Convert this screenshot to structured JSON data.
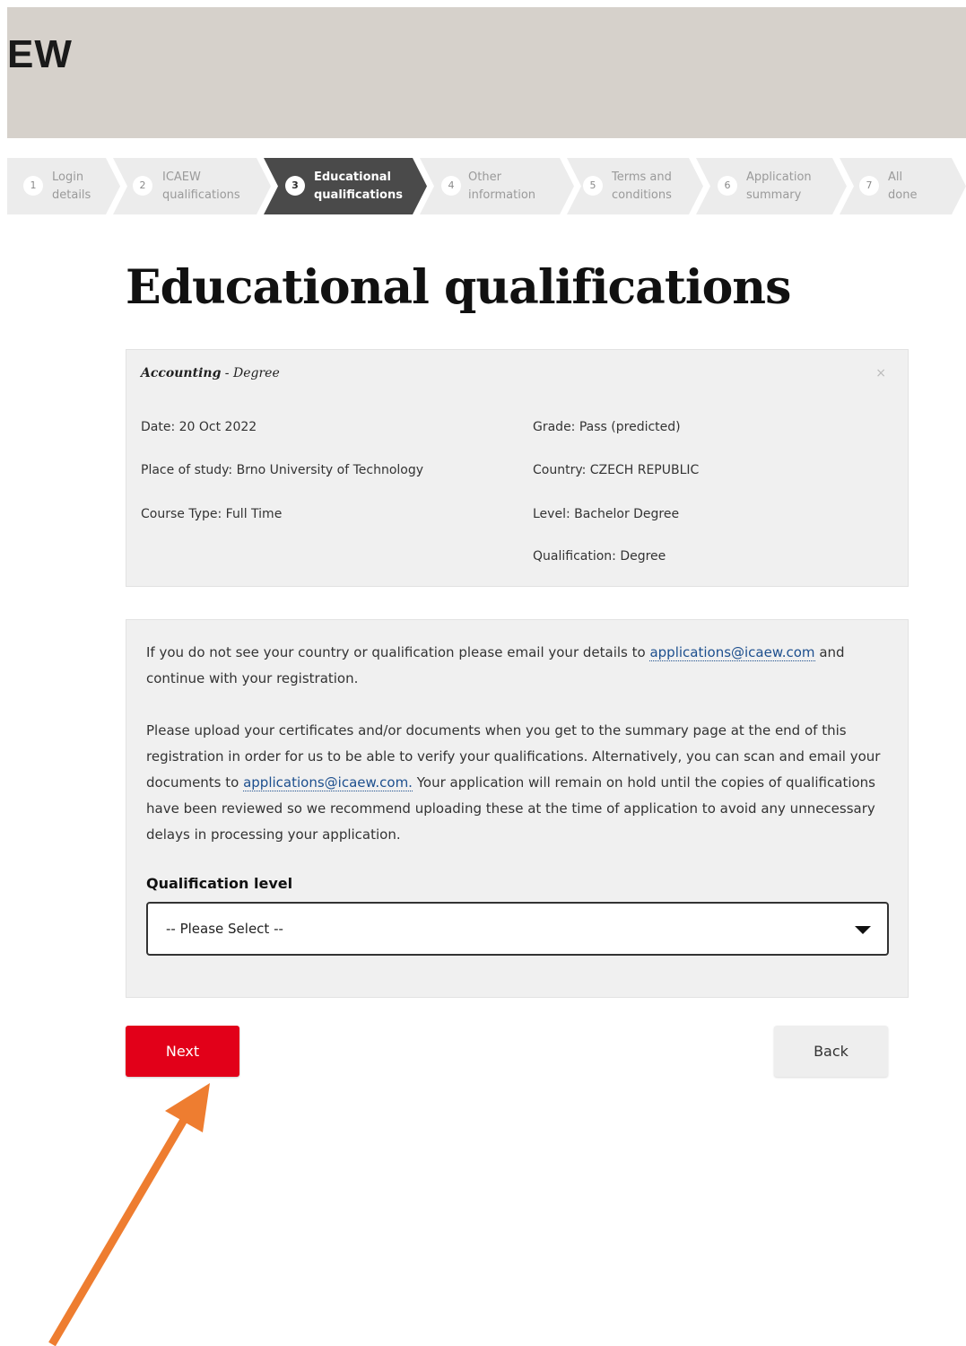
{
  "header": {
    "logo_text": "EW"
  },
  "steps": [
    {
      "num": "1",
      "line1": "Login",
      "line2": "details"
    },
    {
      "num": "2",
      "line1": "ICAEW",
      "line2": "qualifications"
    },
    {
      "num": "3",
      "line1": "Educational",
      "line2": "qualifications"
    },
    {
      "num": "4",
      "line1": "Other",
      "line2": "information"
    },
    {
      "num": "5",
      "line1": "Terms and",
      "line2": "conditions"
    },
    {
      "num": "6",
      "line1": "Application",
      "line2": "summary"
    },
    {
      "num": "7",
      "line1": "All",
      "line2": "done"
    }
  ],
  "active_step": 3,
  "page": {
    "title": "Educational qualifications"
  },
  "qualification": {
    "subject": "Accounting",
    "separator": " - ",
    "type": "Degree",
    "close_symbol": "×",
    "date": "Date: 20 Oct 2022",
    "grade": "Grade: Pass (predicted)",
    "place": "Place of study: Brno University of Technology",
    "country": "Country: CZECH REPUBLIC",
    "course_type": "Course Type: Full Time",
    "level": "Level: Bachelor Degree",
    "qualification": "Qualification: Degree"
  },
  "info": {
    "p1_text": "If you do not see your country or qualification please email your details to ",
    "email": "applications@icaew.com",
    "p1_tail": " and continue with your registration.",
    "p2_text": "Please upload your certificates and/or documents when you get to the summary page at the end of this registration in order for us to be able to verify your qualifications. Alternatively, you can scan and email your documents to ",
    "email2": "applications@icaew.com.",
    "p2_tail": " Your application will remain on hold until the copies of qualifications have been reviewed so we recommend uploading these at the time of application to avoid any unnecessary delays in processing your application.",
    "field_label": "Qualification level",
    "select_value": "-- Please Select --"
  },
  "buttons": {
    "next": "Next",
    "back": "Back"
  },
  "colors": {
    "accent": "#e20019",
    "annotation_arrow": "#ee7d30",
    "link": "#1d4f8e"
  }
}
